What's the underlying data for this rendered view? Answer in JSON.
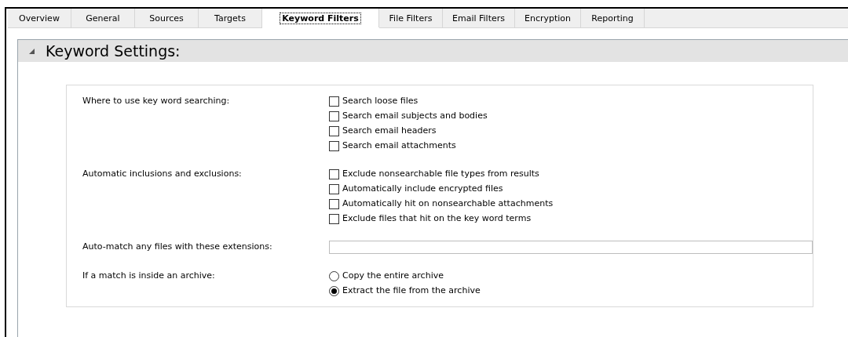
{
  "tabs": [
    {
      "label": "Overview",
      "selected": false
    },
    {
      "label": "General",
      "selected": false
    },
    {
      "label": "Sources",
      "selected": false
    },
    {
      "label": "Targets",
      "selected": false
    },
    {
      "label": "Keyword Filters",
      "selected": true
    },
    {
      "label": "File Filters",
      "selected": false
    },
    {
      "label": "Email Filters",
      "selected": false
    },
    {
      "label": "Encryption",
      "selected": false
    },
    {
      "label": "Reporting",
      "selected": false
    }
  ],
  "section": {
    "title": "Keyword Settings:",
    "expanded": true
  },
  "rows": [
    {
      "kind": "checks",
      "label": "Where to use key word searching:",
      "options": [
        {
          "label": "Search loose files",
          "checked": false
        },
        {
          "label": "Search email subjects and bodies",
          "checked": false
        },
        {
          "label": "Search email headers",
          "checked": false
        },
        {
          "label": "Search email attachments",
          "checked": false
        }
      ]
    },
    {
      "kind": "checks",
      "label": "Automatic inclusions and exclusions:",
      "options": [
        {
          "label": "Exclude nonsearchable file types from results",
          "checked": false
        },
        {
          "label": "Automatically include encrypted files",
          "checked": false
        },
        {
          "label": "Automatically hit on nonsearchable attachments",
          "checked": false
        },
        {
          "label": "Exclude files that hit on the key word terms",
          "checked": false
        }
      ]
    },
    {
      "kind": "text",
      "label": "Auto-match any files with these extensions:"
    },
    {
      "kind": "radios",
      "label": "If a match is inside an archive:",
      "options": [
        {
          "label": "Copy the entire archive",
          "selected": false
        },
        {
          "label": "Extract the file from the archive",
          "selected": true
        }
      ]
    }
  ]
}
